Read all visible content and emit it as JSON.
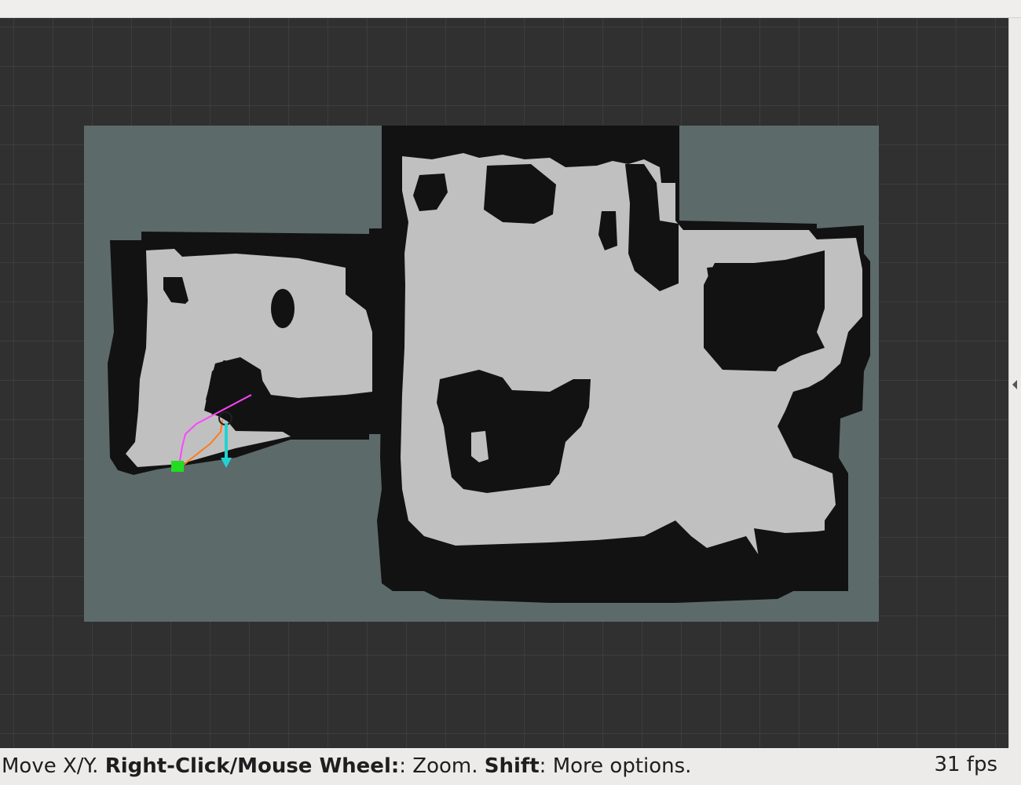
{
  "viewport": {
    "background_color": "#303030",
    "grid_color": "#4a4a4a",
    "unknown_color": "#5c6b6a",
    "free_color": "#c0c0c0",
    "occupied_color": "#121212",
    "path_global_color": "#ff44ff",
    "path_local_color": "#ff7a1a",
    "goal_marker_color": "#22dd22",
    "pose_arrow_color": "#22d3d3"
  },
  "status_bar": {
    "hint_part1": "Move X/Y. ",
    "hint_bold1": "Right-Click/Mouse Wheel:",
    "hint_part2": ": Zoom. ",
    "hint_bold2": "Shift",
    "hint_part3": ": More options.",
    "fps_text": "31 fps"
  },
  "icons": {
    "collapse_panel": "chevron-left-icon"
  }
}
